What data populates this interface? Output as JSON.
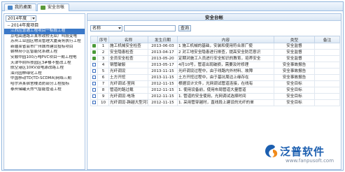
{
  "tabs": [
    {
      "label": "我的桌面",
      "icon": "desktop-icon"
    },
    {
      "label": "安全台帐",
      "icon": "ledger-icon"
    }
  ],
  "left": {
    "year_selected": "2014年度",
    "tree_root": "2014年度项目",
    "items": [
      "江西应急通工程项目一标段工程",
      "京哈高速路上某市政桥无业厂叫段变电",
      "苏州工业园区物流管理大厦商务执行工程",
      "新疆某省会市广州城市建设投标项目",
      "朝林府小区智能化系统工程",
      "安顺中园100万吨PVC项目一期工程电",
      "天津华阴科技园区3#楼不整改工程",
      "航空港区10KV双电源改路工程",
      "滦河园林绿化工程",
      "中国移动TD(TD-SCDMA)网络三期",
      "哈尔滨某宿舍楼消防部分工程投标",
      "泰州储罐天然气智能管道工程"
    ]
  },
  "right": {
    "title": "安全台帐",
    "search_field": "名称",
    "query_label": "查询",
    "columns": [
      "",
      "序号",
      "名称",
      "发生日期",
      "内容",
      "类型",
      "备注"
    ],
    "rows": [
      {
        "icon": "lock",
        "no": "1",
        "name": "施工机械安全检查",
        "date": "2013-06-03",
        "content": "1 施工机械的基础，安装和使用符合原厂使",
        "type": "安全监督",
        "note": ""
      },
      {
        "icon": "lock",
        "no": "2",
        "name": "安全隐患检查",
        "date": "2013-04-17",
        "content": "2 对工地安全隐患进行排查，提高安全防范意识",
        "type": "安全监督",
        "note": ""
      },
      {
        "icon": "lock",
        "no": "3",
        "name": "全员安全检查",
        "date": "2013-05-20",
        "content": "定期对施工人员进行安全知识的教育，培养安全",
        "type": "安全监督",
        "note": ""
      },
      {
        "icon": "edit",
        "no": "4",
        "name": "钢管破裂",
        "date": "2013-05-17",
        "content": "4月10号，管道出现破损，需要及时修理",
        "type": "安全事故报告",
        "note": ""
      },
      {
        "icon": "edit",
        "no": "5",
        "name": "光纤调设",
        "date": "2013-11-15",
        "content": "光纤调设过程中，由于线路内外材料、故障",
        "type": "安全事故报告",
        "note": ""
      },
      {
        "icon": "edit",
        "no": "6",
        "name": "土方开挖",
        "date": "2013-11-15",
        "content": "土方开挖过程中，由于基坑周边上缘存在",
        "type": "安全事故报告",
        "note": ""
      },
      {
        "icon": "edit",
        "no": "7",
        "name": "光纤调试-室网",
        "date": "2012-11-15",
        "content": "根据设计文件，光网调试管道连接，在线有",
        "type": "安全目标",
        "note": ""
      },
      {
        "icon": "edit",
        "no": "8",
        "name": "管道的路过载",
        "date": "2012-11-15",
        "content": "1. 使用设备前，使用布局管道大量管道",
        "type": "安全目标",
        "note": ""
      },
      {
        "icon": "edit",
        "no": "9",
        "name": "光纤调设-电场",
        "date": "2012-11-15",
        "content": "1. 管道的安全使用，光网调试选择时间",
        "type": "安全目标",
        "note": ""
      },
      {
        "icon": "edit",
        "no": "10",
        "name": "光纤调设-跨越大型河流",
        "date": "2012-11-15",
        "content": "1. 采用管穿越时，直线段上建设的光纤的单",
        "type": "安全目标",
        "note": ""
      }
    ]
  },
  "logo": {
    "name": "泛普软件",
    "url": "www.fanpusoft.com"
  },
  "colors": {
    "accent": "#3a78c8",
    "logo_blue": "#1c5fb0",
    "logo_orange": "#f08a1a"
  }
}
